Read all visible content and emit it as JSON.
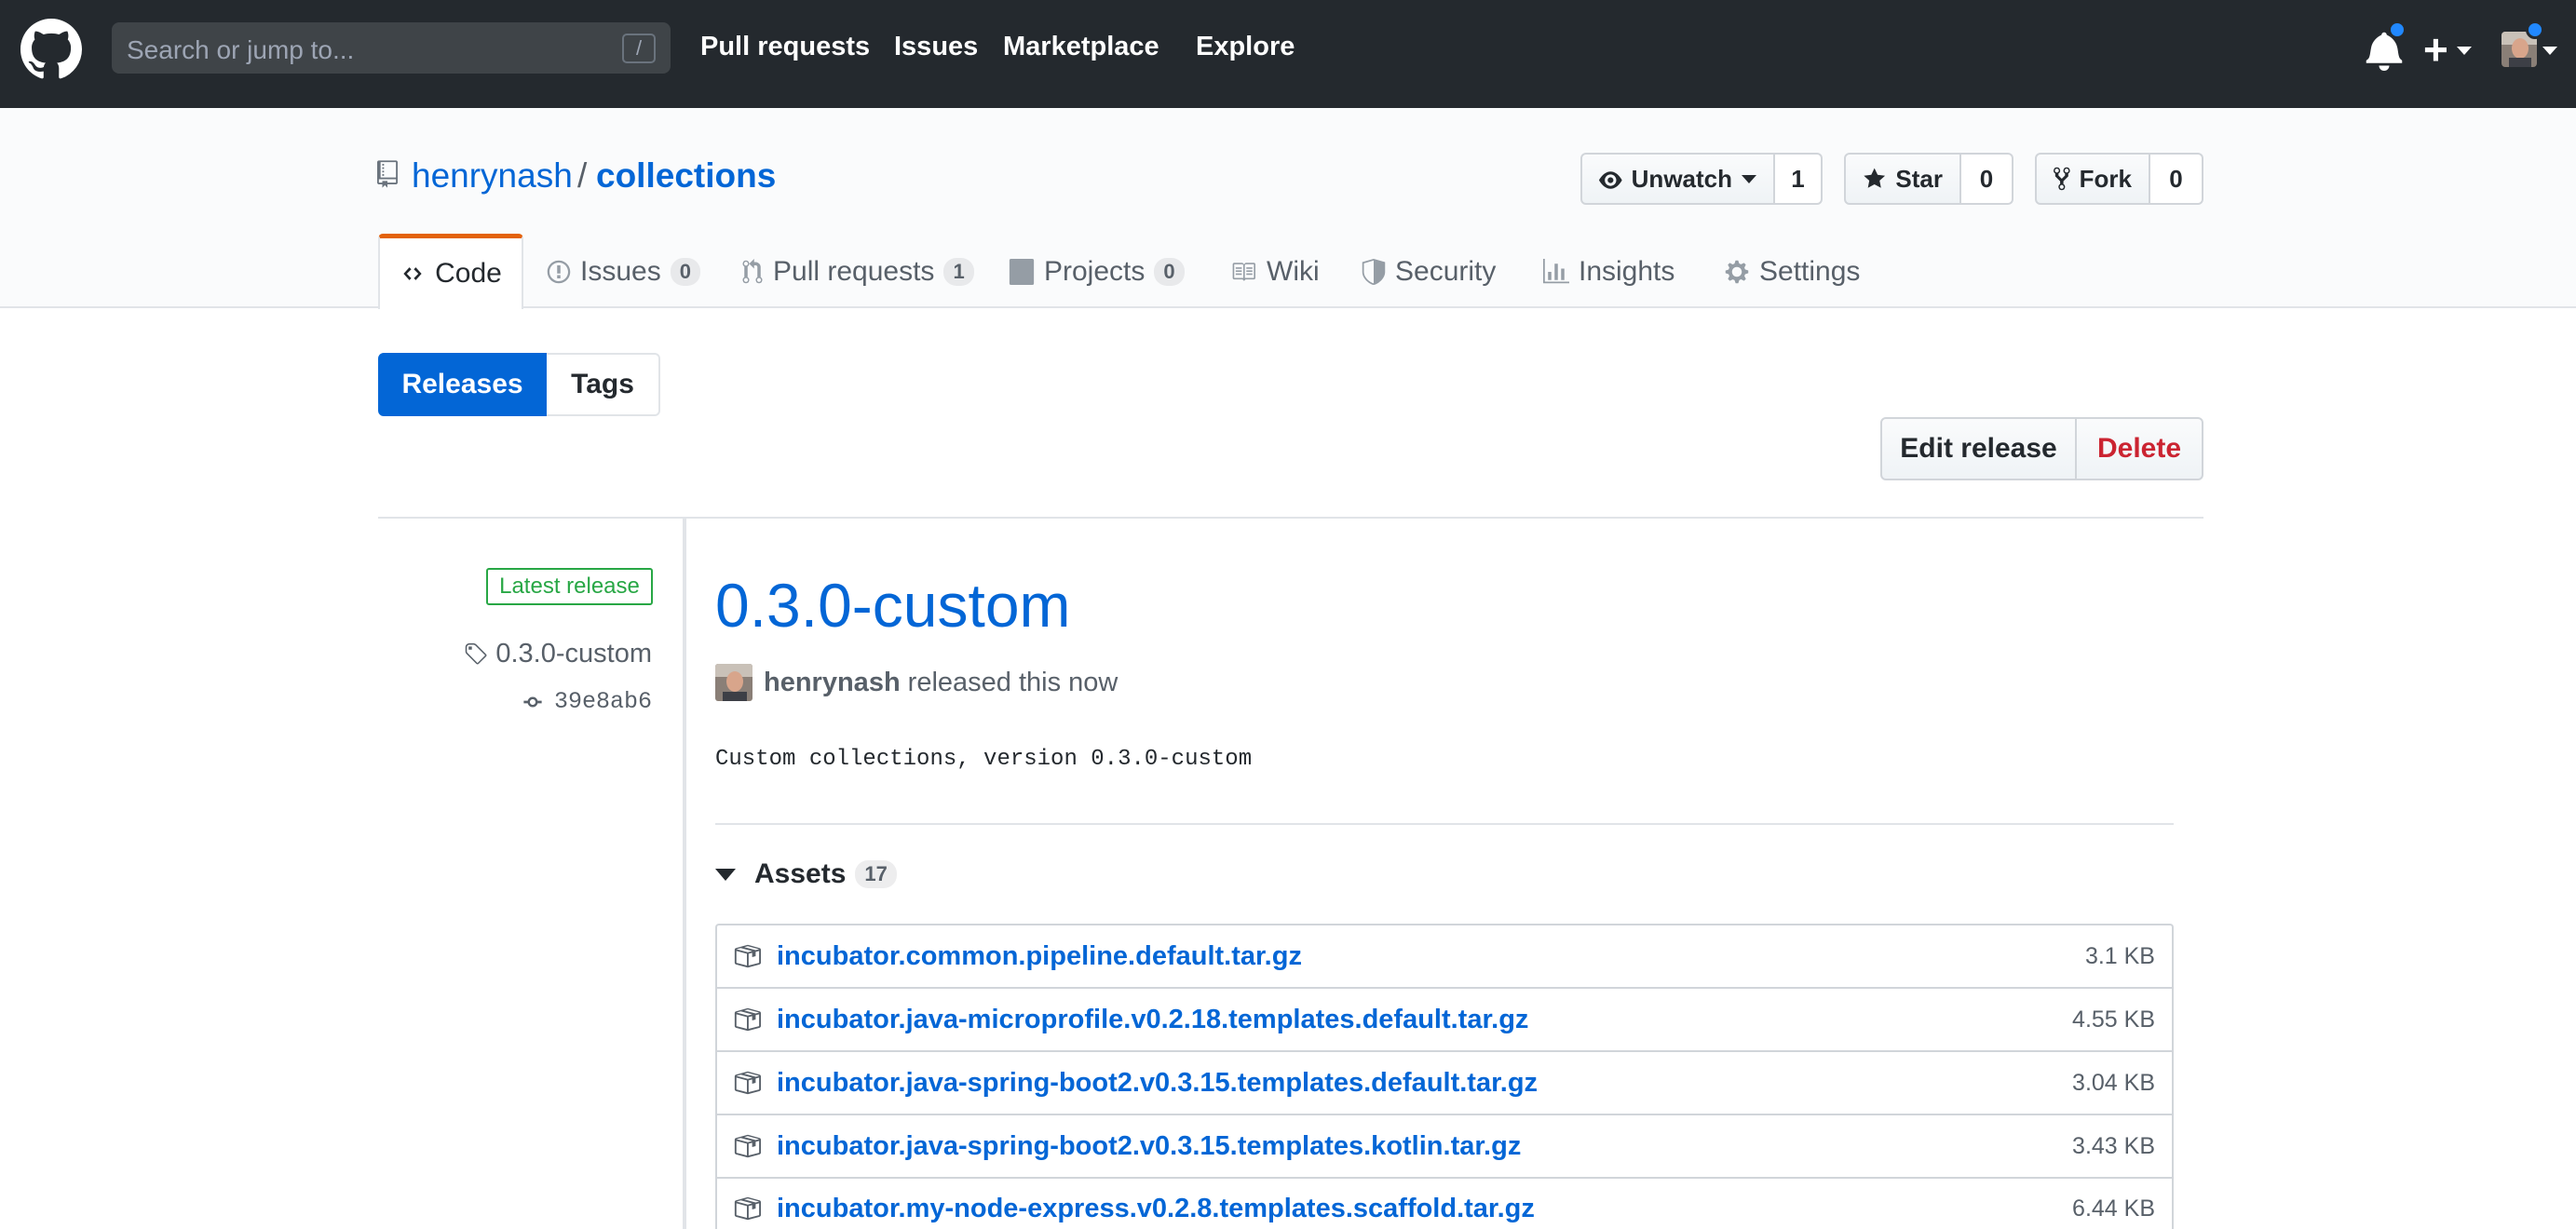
{
  "header": {
    "search_placeholder": "Search or jump to...",
    "search_shortcut": "/",
    "nav": [
      "Pull requests",
      "Issues",
      "Marketplace",
      "Explore"
    ],
    "create_label": "+"
  },
  "repo": {
    "owner": "henrynash",
    "separator": "/",
    "name": "collections",
    "watch": {
      "label": "Unwatch",
      "count": "1"
    },
    "star": {
      "label": "Star",
      "count": "0"
    },
    "fork": {
      "label": "Fork",
      "count": "0"
    }
  },
  "tabs": [
    {
      "label": "Code",
      "count": ""
    },
    {
      "label": "Issues",
      "count": "0"
    },
    {
      "label": "Pull requests",
      "count": "1"
    },
    {
      "label": "Projects",
      "count": "0"
    },
    {
      "label": "Wiki",
      "count": ""
    },
    {
      "label": "Security",
      "count": ""
    },
    {
      "label": "Insights",
      "count": ""
    },
    {
      "label": "Settings",
      "count": ""
    }
  ],
  "subnav": {
    "releases": "Releases",
    "tags": "Tags"
  },
  "actions": {
    "edit": "Edit release",
    "delete": "Delete"
  },
  "release": {
    "badge": "Latest release",
    "tag": "0.3.0-custom",
    "commit": "39e8ab6",
    "title": "0.3.0-custom",
    "author": "henrynash",
    "released_text": "released this now",
    "description": "Custom collections, version 0.3.0-custom",
    "assets_label": "Assets",
    "assets_count": "17",
    "assets": [
      {
        "name": "incubator.common.pipeline.default.tar.gz",
        "size": "3.1 KB"
      },
      {
        "name": "incubator.java-microprofile.v0.2.18.templates.default.tar.gz",
        "size": "4.55 KB"
      },
      {
        "name": "incubator.java-spring-boot2.v0.3.15.templates.default.tar.gz",
        "size": "3.04 KB"
      },
      {
        "name": "incubator.java-spring-boot2.v0.3.15.templates.kotlin.tar.gz",
        "size": "3.43 KB"
      },
      {
        "name": "incubator.my-node-express.v0.2.8.templates.scaffold.tar.gz",
        "size": "6.44 KB"
      }
    ]
  },
  "colors": {
    "header_bg": "#24292e",
    "link": "#0366d6",
    "accent_tab": "#e36209",
    "green": "#28a745",
    "danger": "#cb2431"
  }
}
